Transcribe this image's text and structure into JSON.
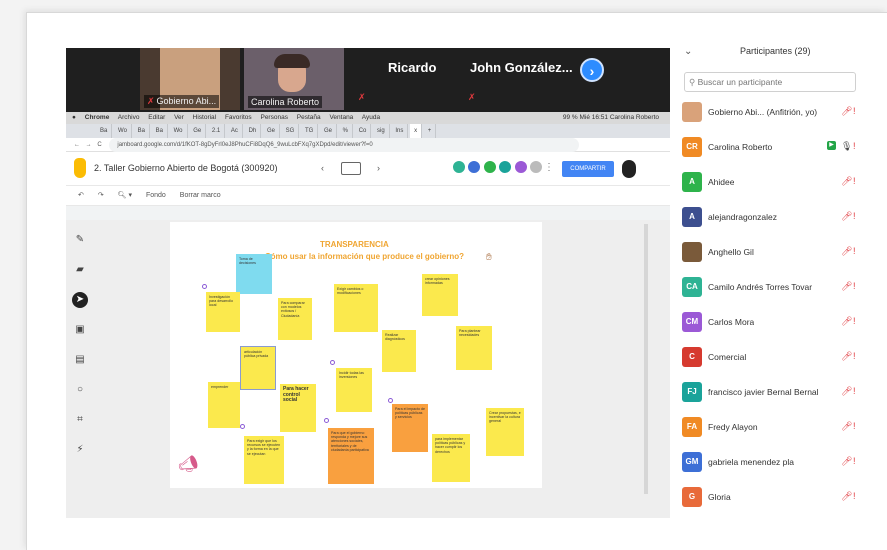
{
  "video_strip": {
    "tiles": [
      {
        "name": "Gobierno Abi..."
      },
      {
        "name": "Carolina Roberto"
      }
    ],
    "names_large": [
      "Ricardo",
      "John  González..."
    ],
    "next_icon": "chevron-right-icon"
  },
  "mac_menu": [
    "Chrome",
    "Archivo",
    "Editar",
    "Ver",
    "Historial",
    "Favoritos",
    "Personas",
    "Pestaña",
    "Ventana",
    "Ayuda"
  ],
  "mac_menu_right": "99 %  Mié 16:51  Carolina Roberto",
  "browser": {
    "address": "jamboard.google.com/d/1fKOT-8gDyFrl0eJ8PhuCFi8DqQ6_9wuLcbFXq7gXDpd/edit/viewer?f=0"
  },
  "jamboard": {
    "title": "2. Taller Gobierno Abierto de Bogotá (300920)",
    "share_label": "COMPARTIR",
    "toolbar": [
      "Fondo",
      "Borrar marco"
    ],
    "board_title": "TRANSPARENCIA",
    "board_subtitle": "¿Cómo usar la información que produce el gobierno?",
    "notes": [
      {
        "text": "Toma de decisiones"
      },
      {
        "text": "Investigación para desarrollo local"
      },
      {
        "text": "Para comparar con modelos exitosos / Ciudadanía"
      },
      {
        "text": "Exigir cambios o modificaciones"
      },
      {
        "text": "crear opiniones informadas"
      },
      {
        "text": "Realizar diagnósticos"
      },
      {
        "text": "Para plantear necesidades"
      },
      {
        "text": "articulación pública privada"
      },
      {
        "text": "Para hacer control social"
      },
      {
        "text": "Incidir todas las inversiones"
      },
      {
        "text": "emprender"
      },
      {
        "text": "Para el impacto de políticas públicas y servicios"
      },
      {
        "text": "Crear propuestas, e incentivar la cultura general"
      },
      {
        "text": "Para que el gobierno responda y mejore sus atenciones sociales, territoriales y de ciudadanía participativa"
      },
      {
        "text": "para implementar políticas públicas y hacer cumplir los derechos"
      },
      {
        "text": "Para exigir que los recursos se ejecuten y la forma en la que se ejecutan"
      }
    ]
  },
  "participants": {
    "title": "Participantes (29)",
    "search_placeholder": "Buscar un participante",
    "list": [
      {
        "initials": "",
        "name": "Gobierno Abi... (Anfitrión, yo)",
        "color": "#d9a27a",
        "photo": true
      },
      {
        "initials": "CR",
        "name": "Carolina Roberto",
        "color": "#f08a24"
      },
      {
        "initials": "A",
        "name": "Ahidee",
        "color": "#2eb34b"
      },
      {
        "initials": "A",
        "name": "alejandragonzalez",
        "color": "#3d4f8f"
      },
      {
        "initials": "",
        "name": "Anghello Gil",
        "color": "#7a5a3a",
        "photo": true
      },
      {
        "initials": "CA",
        "name": "Camilo Andrés Torres Tovar",
        "color": "#2eb394"
      },
      {
        "initials": "CM",
        "name": "Carlos Mora",
        "color": "#9b59d6"
      },
      {
        "initials": "C",
        "name": "Comercial",
        "color": "#d63a2f"
      },
      {
        "initials": "FJ",
        "name": "francisco javier Bernal Bernal",
        "color": "#1aa39a"
      },
      {
        "initials": "FA",
        "name": "Fredy Alayon",
        "color": "#f08a24"
      },
      {
        "initials": "GM",
        "name": "gabriela menendez pla",
        "color": "#3d6fd6"
      },
      {
        "initials": "G",
        "name": "Gloria",
        "color": "#e86a3a"
      }
    ]
  }
}
